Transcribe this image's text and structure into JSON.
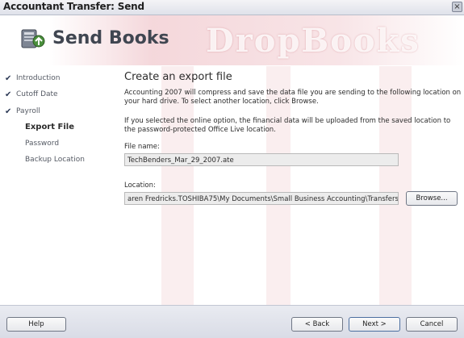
{
  "window": {
    "title": "Accountant Transfer: Send",
    "close_glyph": "×"
  },
  "header": {
    "title": "Send Books",
    "icon": "send-books-icon",
    "watermark": "DropBooks"
  },
  "sidebar": {
    "items": [
      {
        "label": "Introduction",
        "done": true,
        "check": "✔"
      },
      {
        "label": "Cutoff Date",
        "done": true,
        "check": "✔"
      },
      {
        "label": "Payroll",
        "done": true,
        "check": "✔"
      },
      {
        "label": "Export File",
        "active": true
      },
      {
        "label": "Password"
      },
      {
        "label": "Backup Location"
      }
    ]
  },
  "main": {
    "heading": "Create an export file",
    "para1": "Accounting 2007 will compress and save the data file you are sending to the following location on your hard drive. To select another location, click Browse.",
    "para2": "If you selected the online option, the financial data will be uploaded from the saved location to the password-protected Office Live location.",
    "file_name_label": "File name:",
    "file_name_value": "TechBenders_Mar_29_2007.ate",
    "location_label": "Location:",
    "location_value": "aren Fredricks.TOSHIBA75\\My Documents\\Small Business Accounting\\Transfers",
    "browse_label": "Browse..."
  },
  "footer": {
    "help_label": "Help",
    "back_label": "< Back",
    "next_label": "Next >",
    "cancel_label": "Cancel"
  },
  "colors": {
    "accent": "#c52438",
    "sidebar_text": "#555a64",
    "button_border": "#707785"
  }
}
